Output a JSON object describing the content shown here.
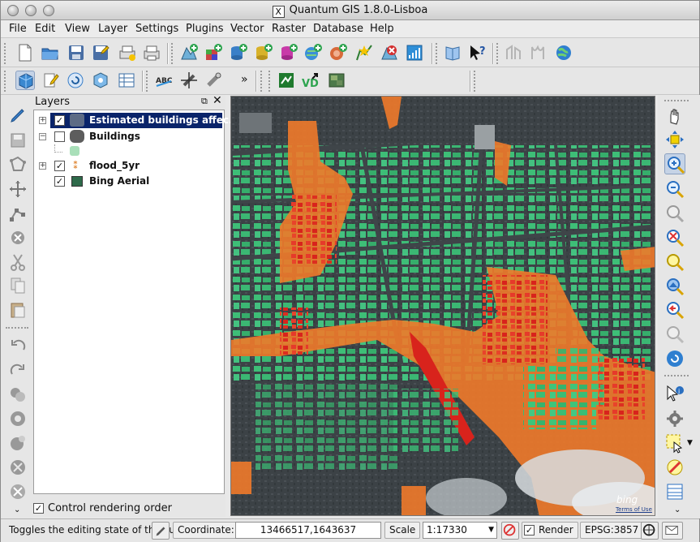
{
  "window": {
    "title": "Quantum GIS 1.8.0-Lisboa",
    "x_logo": "X"
  },
  "menubar": {
    "items": [
      "File",
      "Edit",
      "View",
      "Layer",
      "Settings",
      "Plugins",
      "Vector",
      "Raster",
      "Database",
      "Help"
    ]
  },
  "layers_panel": {
    "title": "Layers",
    "layers": [
      {
        "name": "Estimated buildings affec...",
        "checked": true,
        "selected": true,
        "expanded": false
      },
      {
        "name": "Buildings",
        "checked": false,
        "selected": false,
        "expanded": true
      },
      {
        "name": "flood_5yr",
        "checked": true,
        "selected": false,
        "expanded": false
      },
      {
        "name": "Bing Aerial",
        "checked": true,
        "selected": false,
        "expanded": null
      }
    ],
    "control_rendering_order": {
      "label": "Control rendering order",
      "checked": true
    },
    "float_icon": "float-icon",
    "close_icon": "close-icon"
  },
  "toolbar2": {
    "more_label": "»"
  },
  "map": {
    "watermark": "bing",
    "terms": "Terms of Use"
  },
  "statusbar": {
    "message": "Toggles the editing state of the cu",
    "coordinate_label": "Coordinate:",
    "coordinate_value": "13466517,1643637",
    "scale_label": "Scale",
    "scale_value": "1:17330",
    "render_label": "Render",
    "render_checked": true,
    "crs": "EPSG:3857"
  },
  "colors": {
    "selected_row": "#0a246a",
    "building_green": "#3ec47a",
    "flood_orange": "#f07a2a",
    "flood_red": "#d8231c"
  }
}
